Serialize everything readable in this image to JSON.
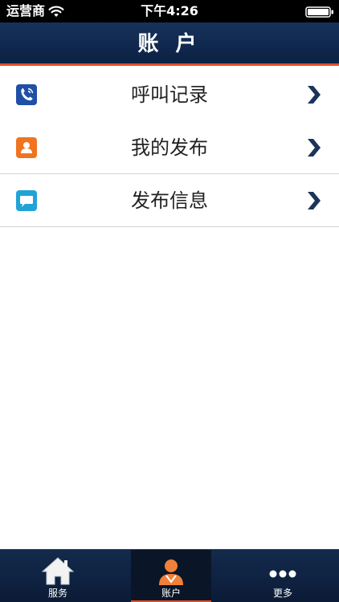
{
  "status_bar": {
    "carrier": "运营商",
    "time": "下午4:26"
  },
  "nav": {
    "title": "账 户"
  },
  "menu": {
    "items": [
      {
        "label": "呼叫记录",
        "icon": "phone-icon",
        "icon_color": "#1f4fa6"
      },
      {
        "label": "我的发布",
        "icon": "contact-card-icon",
        "icon_color": "#f07420"
      },
      {
        "label": "发布信息",
        "icon": "chat-bubble-icon",
        "icon_color": "#22a3d6"
      }
    ]
  },
  "tab_bar": {
    "tabs": [
      {
        "label": "服务",
        "icon": "home-icon",
        "active": false
      },
      {
        "label": "账户",
        "icon": "user-avatar-icon",
        "active": true
      },
      {
        "label": "更多",
        "icon": "more-dots-icon",
        "active": false
      }
    ]
  },
  "colors": {
    "nav_background": "#16325c",
    "accent": "#e0502a",
    "chevron": "#1b3459"
  }
}
